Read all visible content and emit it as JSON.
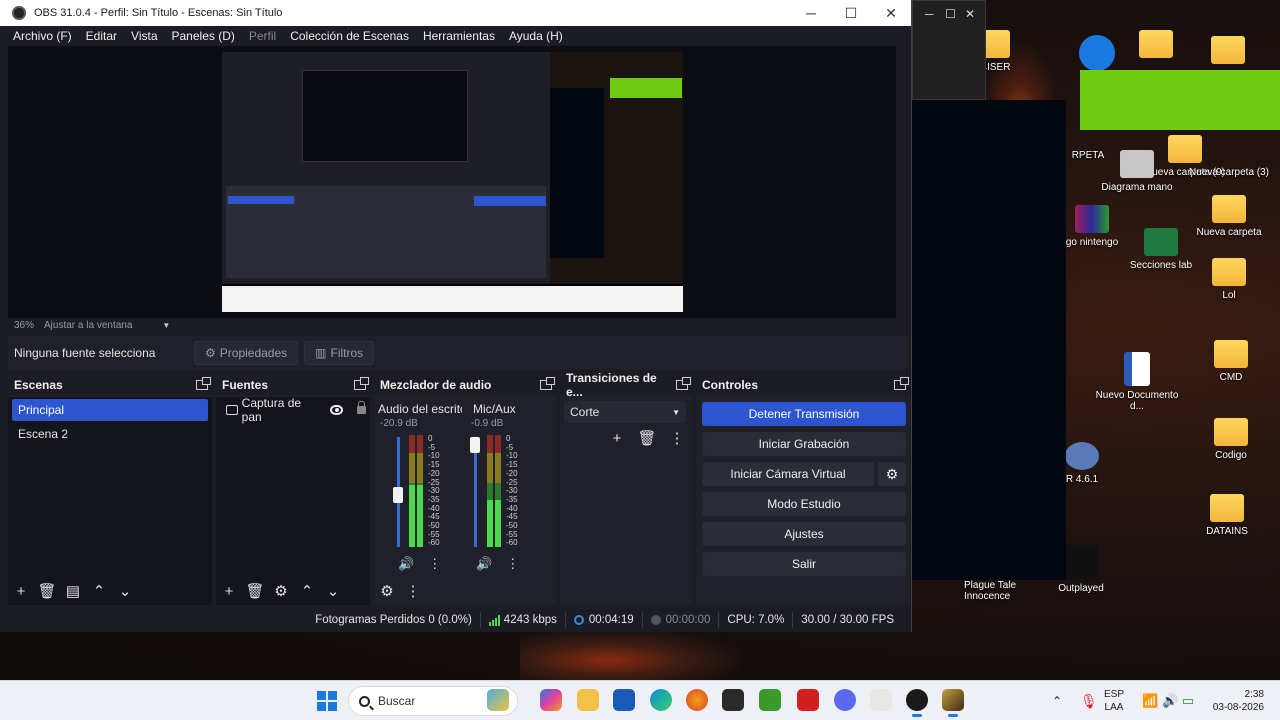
{
  "window": {
    "title": "OBS 31.0.4 - Perfil: Sin Título - Escenas: Sin Título",
    "minimize": "─",
    "maximize": "☐",
    "close": "✕"
  },
  "menu": [
    "Archivo (F)",
    "Editar",
    "Vista",
    "Paneles (D)",
    "Perfil",
    "Colección de Escenas",
    "Herramientas",
    "Ayuda (H)"
  ],
  "preview": {
    "zoom": "36%",
    "fit": "Ajustar a la ventana"
  },
  "source_bar": {
    "no_selection": "Ninguna fuente selecciona",
    "properties": "Propiedades",
    "filters": "Filtros"
  },
  "docks": {
    "scenes": {
      "title": "Escenas",
      "items": [
        "Principal",
        "Escena 2"
      ],
      "active_index": 0
    },
    "sources": {
      "title": "Fuentes",
      "items": [
        "Captura de pan"
      ]
    },
    "mixer": {
      "title": "Mezclador de audio",
      "channels": [
        {
          "name": "Audio del escrito",
          "db": "-20.9 dB",
          "level": 0.55
        },
        {
          "name": "Mic/Aux",
          "db": "-0.9 dB",
          "level": 0.42
        }
      ],
      "scale": [
        "0",
        "-5",
        "-10",
        "-15",
        "-20",
        "-25",
        "-30",
        "-35",
        "-40",
        "-45",
        "-50",
        "-55",
        "-60"
      ]
    },
    "transitions": {
      "title": "Transiciones de e...",
      "selected": "Corte"
    },
    "controls": {
      "title": "Controles",
      "stop_stream": "Detener Transmisión",
      "start_recording": "Iniciar Grabación",
      "start_virtual_cam": "Iniciar Cámara Virtual",
      "studio_mode": "Modo Estudio",
      "settings": "Ajustes",
      "exit": "Salir"
    }
  },
  "status": {
    "dropped_frames": "Fotogramas Perdidos 0 (0.0%)",
    "bitrate": "4243 kbps",
    "stream_time": "00:04:19",
    "rec_time": "00:00:00",
    "cpu": "CPU: 7.0%",
    "fps": "30.00 / 30.00 FPS"
  },
  "desktop": {
    "icons": [
      "Nueva carpeta (9)",
      "Nueva carpeta (3)",
      "Diagrama mano",
      "Nueva carpeta",
      "go nintengo",
      "Secciones lab",
      "Lol",
      "CMD",
      "Nuevo Documento d...",
      "R 4.6.1",
      "Codigo",
      "DATAINS",
      "Plague Tale Innocence",
      "Outplayed",
      "RPETA",
      "4ISER",
      "Nueva carpeta"
    ]
  },
  "taskbar": {
    "search_placeholder": "Buscar",
    "lang_1": "ESP",
    "lang_2": "LAA",
    "time": "2:38",
    "date": "03-08-2026"
  },
  "colors": {
    "accent": "#2d55d0",
    "obs_bg": "#1b1c24",
    "panel_bg": "#14151c",
    "green_block": "#6fcc12"
  }
}
